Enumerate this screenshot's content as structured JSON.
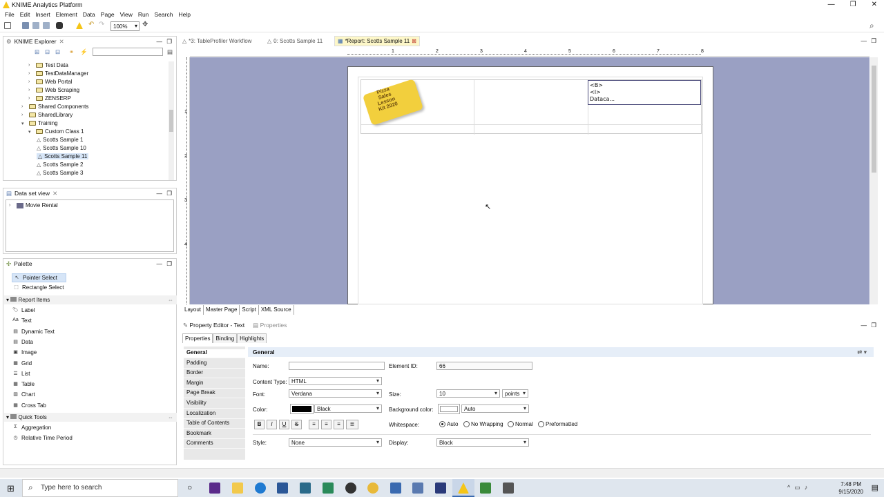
{
  "app": {
    "title": "KNIME Analytics Platform"
  },
  "menu": [
    "File",
    "Edit",
    "Insert",
    "Element",
    "Data",
    "Page",
    "View",
    "Run",
    "Search",
    "Help"
  ],
  "toolbar": {
    "zoom": "100%"
  },
  "explorer": {
    "title": "KNIME Explorer",
    "items": [
      {
        "label": "Test Data",
        "type": "folder",
        "level": 1
      },
      {
        "label": "TestDataManager",
        "type": "folder",
        "level": 1
      },
      {
        "label": "Web Portal",
        "type": "folder",
        "level": 1
      },
      {
        "label": "Web Scraping",
        "type": "folder",
        "level": 1
      },
      {
        "label": "ZENSERP",
        "type": "folder",
        "level": 1
      },
      {
        "label": "Shared Components",
        "type": "folder",
        "level": 0
      },
      {
        "label": "SharedLibrary",
        "type": "folder",
        "level": 0
      },
      {
        "label": "Training",
        "type": "folder",
        "level": 0
      },
      {
        "label": "Custom Class 1",
        "type": "folder",
        "level": 1
      },
      {
        "label": "Scotts Sample 1",
        "type": "workflow",
        "level": 2
      },
      {
        "label": "Scotts Sample 10",
        "type": "workflow",
        "level": 2
      },
      {
        "label": "Scotts Sample 11",
        "type": "workflow",
        "level": 2
      },
      {
        "label": "Scotts Sample 2",
        "type": "workflow",
        "level": 2
      },
      {
        "label": "Scotts Sample 3",
        "type": "workflow",
        "level": 2
      }
    ]
  },
  "dataset_view": {
    "title": "Data set view",
    "items": [
      "Movie Rental"
    ]
  },
  "palette": {
    "title": "Palette",
    "tools": [
      "Pointer Select",
      "Rectangle Select"
    ],
    "report_items_title": "Report Items",
    "report_items": [
      "Label",
      "Text",
      "Dynamic Text",
      "Data",
      "Image",
      "Grid",
      "List",
      "Table",
      "Chart",
      "Cross Tab"
    ],
    "quick_tools_title": "Quick Tools",
    "quick_tools": [
      "Aggregation",
      "Relative Time Period"
    ]
  },
  "editor_tabs": [
    {
      "label": "*3: TableProfiler Workflow",
      "active": false
    },
    {
      "label": "0: Scotts Sample 11",
      "active": false
    },
    {
      "label": "*Report: Scotts Sample 11",
      "active": true
    }
  ],
  "ruler_marks": [
    "1",
    "2",
    "3",
    "4",
    "5",
    "6",
    "7",
    "8"
  ],
  "ruler_v_marks": [
    "1",
    "2",
    "3",
    "4"
  ],
  "report": {
    "logo_text": [
      "Pizza",
      "Sales",
      "Lesson",
      "Kit 2020"
    ],
    "text_cell": [
      "<B>",
      "<I>",
      "Dataca..."
    ]
  },
  "layout_tabs": [
    "Layout",
    "Master Page",
    "Script",
    "XML Source"
  ],
  "property_editor": {
    "title": "Property Editor - Text",
    "properties_tab": "Properties",
    "sub_tabs": [
      "Properties",
      "Binding",
      "Highlights"
    ],
    "categories": [
      "General",
      "Padding",
      "Border",
      "Margin",
      "Page Break",
      "Visibility",
      "Localization",
      "Table of Contents",
      "Bookmark",
      "Comments"
    ],
    "general_title": "General",
    "name_label": "Name:",
    "name_value": "",
    "element_id_label": "Element ID:",
    "element_id_value": "66",
    "content_type_label": "Content Type:",
    "content_type_value": "HTML",
    "font_label": "Font:",
    "font_value": "Verdana",
    "size_label": "Size:",
    "size_value": "10",
    "size_unit": "points",
    "color_label": "Color:",
    "color_value": "Black",
    "bg_color_label": "Background color:",
    "bg_color_value": "Auto",
    "whitespace_label": "Whitespace:",
    "whitespace_options": [
      "Auto",
      "No Wrapping",
      "Normal",
      "Preformatted"
    ],
    "whitespace_selected": "Auto",
    "style_label": "Style:",
    "style_value": "None",
    "display_label": "Display:",
    "display_value": "Block"
  },
  "taskbar": {
    "search_placeholder": "Type here to search",
    "time": "7:48 PM",
    "date": "9/15/2020"
  }
}
